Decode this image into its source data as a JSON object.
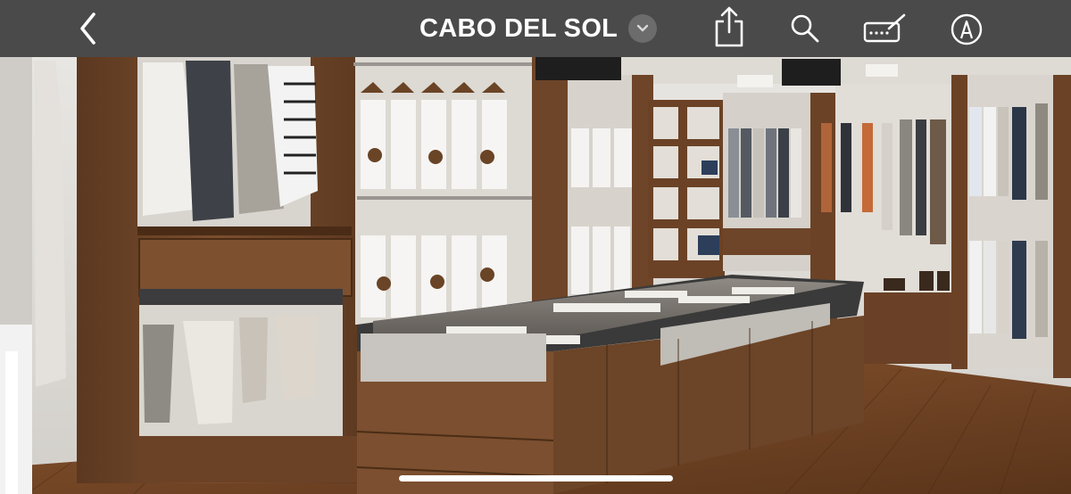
{
  "topbar": {
    "back_icon": "chevron-left-icon",
    "title": "CABO DEL SOL",
    "title_menu_icon": "chevron-down-icon",
    "actions": [
      {
        "name": "share-icon"
      },
      {
        "name": "search-icon"
      },
      {
        "name": "keyboard-pen-icon"
      },
      {
        "name": "markup-pen-icon"
      }
    ]
  },
  "colors": {
    "topbar_bg": "#4a4a4a",
    "icon": "#ffffff",
    "wood": "#6b4328",
    "floor": "#7a4a26"
  },
  "photo": {
    "subject": "walk-in-closet-photo"
  }
}
